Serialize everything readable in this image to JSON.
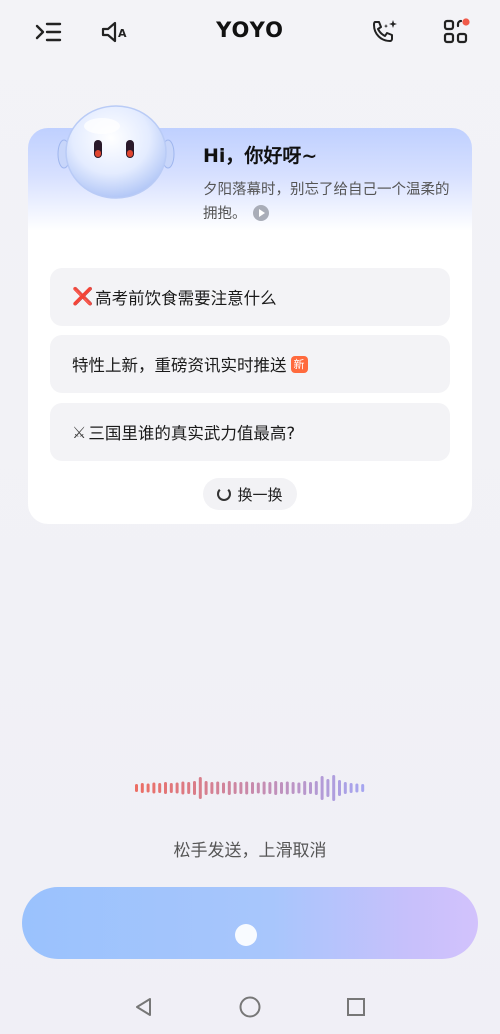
{
  "app": {
    "title": "YOYO"
  },
  "topbar": {
    "menu_icon": "menu-collapse-icon",
    "speaker_icon": "speaker-mute-auto-icon",
    "call_icon": "phone-sparkle-icon",
    "apps_icon": "apps-grid-icon"
  },
  "greeting": {
    "title": "Hi，你好呀~",
    "subtitle": "夕阳落幕时，别忘了给自己一个温柔的拥抱。"
  },
  "suggestions": [
    {
      "prefix": "❌",
      "text": "高考前饮食需要注意什么",
      "badge": ""
    },
    {
      "prefix": "",
      "text": "特性上新，重磅资讯实时推送",
      "badge": "新"
    },
    {
      "prefix": "⚔",
      "text": "三国里谁的真实武力值最高?",
      "badge": ""
    }
  ],
  "refresh_label": "换一换",
  "voice": {
    "hint": "松手发送，上滑取消"
  },
  "colors": {
    "accent_blue": "#9ac2fd",
    "accent_purple": "#d2c2fc",
    "badge_orange": "#ff6a3d"
  }
}
